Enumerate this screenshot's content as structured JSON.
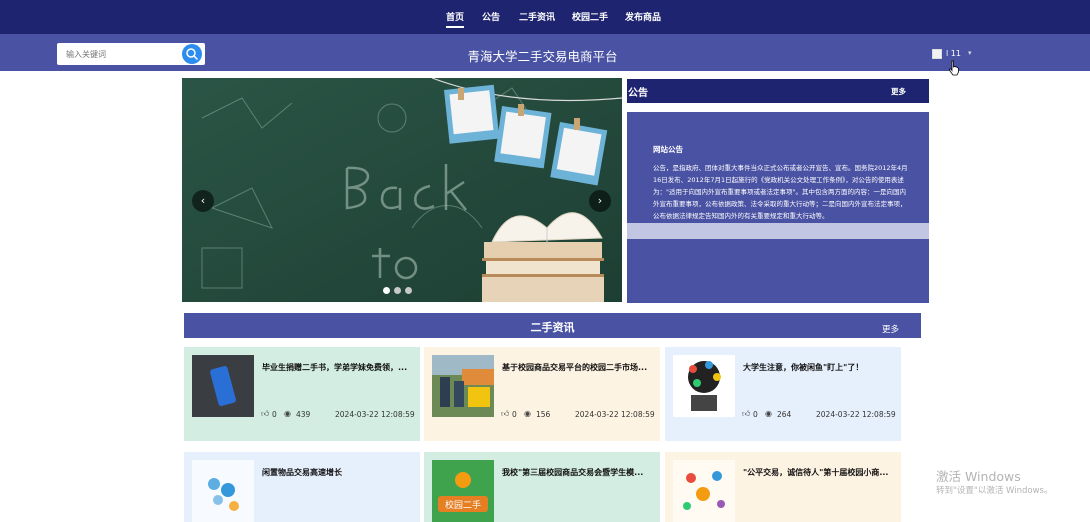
{
  "nav": {
    "items": [
      "首页",
      "公告",
      "二手资讯",
      "校园二手",
      "发布商品"
    ],
    "active_index": 0
  },
  "header": {
    "search_placeholder": "输入关键词",
    "site_title": "青海大学二手交易电商平台",
    "user_name": "l 11"
  },
  "carousel": {
    "dots": 3,
    "active_dot": 0
  },
  "notice": {
    "title": "公告",
    "more": "更多",
    "heading": "网站公告",
    "text": "公告，是指政府、团体对重大事件当众正式公布或者公开宣告、宣布。国务院2012年4月16日发布、2012年7月1日起施行的《党政机关公文处理工作条例》，对公告的使用表述为：\"适用于向国内外宣布重要事项或者法定事项\"。其中包含两方面的内容：一是向国内外宣布重要事项，公布依据政策、法令采取的重大行动等；二是向国内外宣布法定事项，公布依据法律规定告知国内外的有关重要规定和重大行动等。"
  },
  "news": {
    "title": "二手资讯",
    "more": "更多",
    "cards": [
      {
        "title": "毕业生捐赠二手书，学弟学妹免费领，...",
        "likes": "0",
        "views": "439",
        "date": "2024-03-22 12:08:59"
      },
      {
        "title": "基于校园商品交易平台的校园二手市场...",
        "likes": "0",
        "views": "156",
        "date": "2024-03-22 12:08:59"
      },
      {
        "title": "大学生注意，你被闲鱼\"盯上\"了！",
        "likes": "0",
        "views": "264",
        "date": "2024-03-22 12:08:59"
      },
      {
        "title": "闲置物品交易高速增长"
      },
      {
        "title": "我校\"第三届校园商品交易会暨学生模..."
      },
      {
        "title": "\"公平交易，诚信待人\"第十届校园小商..."
      }
    ]
  },
  "colors": {
    "nav_bg": "#1e2470",
    "header_bg": "#4a52a3",
    "card_green": "#d3ede3",
    "card_cream": "#fdf3e2",
    "card_blue": "#e6effc"
  },
  "watermark": {
    "line1": "激活 Windows",
    "line2": "转到\"设置\"以激活 Windows。"
  }
}
